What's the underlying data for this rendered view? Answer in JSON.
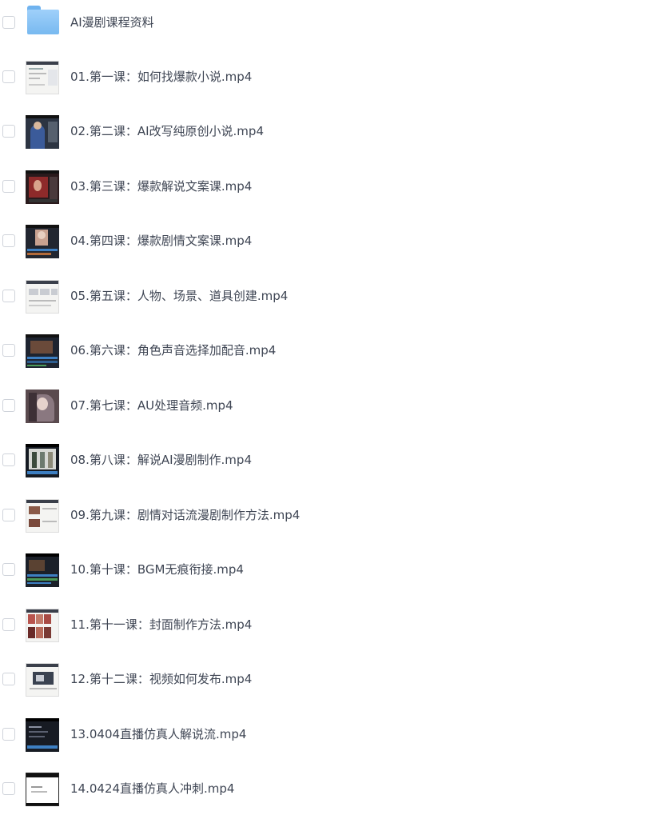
{
  "folder": {
    "name": "AI漫剧课程资料",
    "icon": "folder-icon"
  },
  "files": [
    {
      "name": "01.第一课：如何找爆款小说.mp4",
      "thumb": "video-thumbnail"
    },
    {
      "name": "02.第二课：AI改写纯原创小说.mp4",
      "thumb": "video-thumbnail"
    },
    {
      "name": "03.第三课：爆款解说文案课.mp4",
      "thumb": "video-thumbnail"
    },
    {
      "name": "04.第四课：爆款剧情文案课.mp4",
      "thumb": "video-thumbnail"
    },
    {
      "name": "05.第五课：人物、场景、道具创建.mp4",
      "thumb": "video-thumbnail"
    },
    {
      "name": "06.第六课：角色声音选择加配音.mp4",
      "thumb": "video-thumbnail"
    },
    {
      "name": "07.第七课：AU处理音频.mp4",
      "thumb": "video-thumbnail"
    },
    {
      "name": "08.第八课：解说AI漫剧制作.mp4",
      "thumb": "video-thumbnail"
    },
    {
      "name": "09.第九课：剧情对话流漫剧制作方法.mp4",
      "thumb": "video-thumbnail"
    },
    {
      "name": "10.第十课：BGM无痕衔接.mp4",
      "thumb": "video-thumbnail"
    },
    {
      "name": "11.第十一课：封面制作方法.mp4",
      "thumb": "video-thumbnail"
    },
    {
      "name": "12.第十二课：视频如何发布.mp4",
      "thumb": "video-thumbnail"
    },
    {
      "name": "13.0404直播仿真人解说流.mp4",
      "thumb": "video-thumbnail"
    },
    {
      "name": "14.0424直播仿真人冲刺.mp4",
      "thumb": "video-thumbnail"
    }
  ],
  "colors": {
    "text": "#3f4654",
    "checkbox_border": "#cfd3da",
    "folder": "#7dbdf2"
  }
}
